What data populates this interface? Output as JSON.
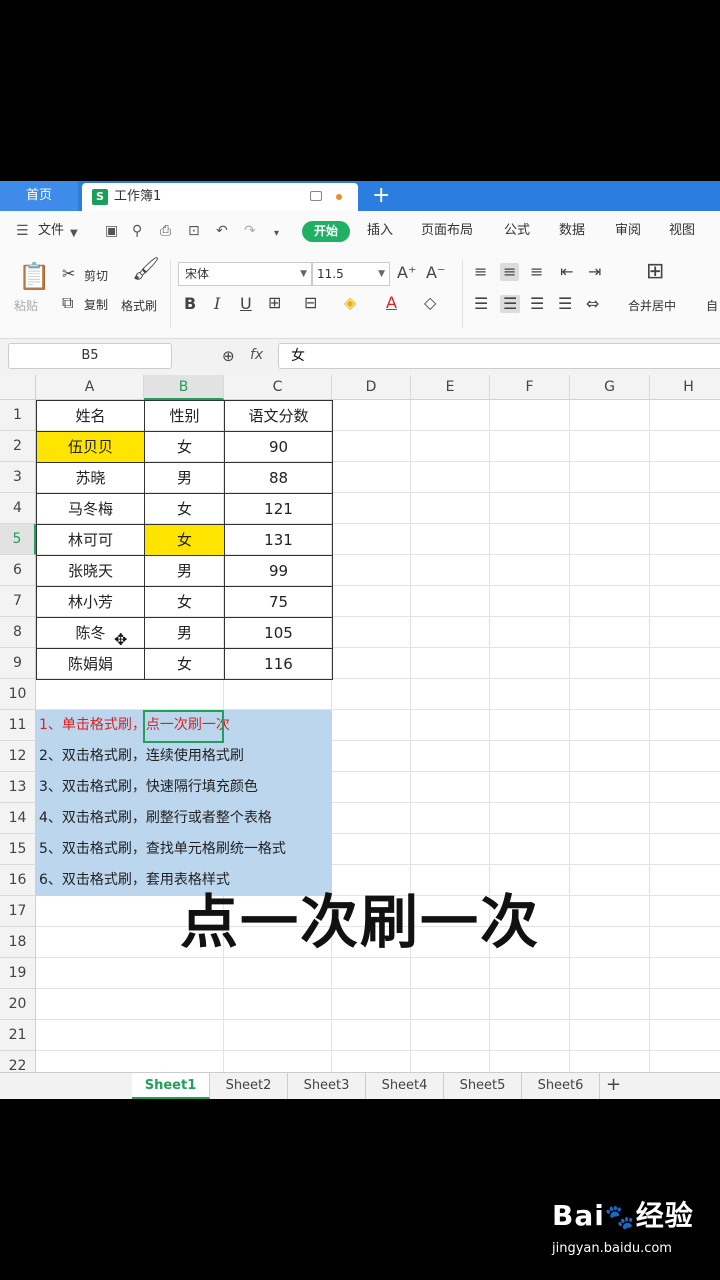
{
  "tabs": {
    "home": "首页",
    "doc": "工作簿1",
    "new_tab": "+"
  },
  "menu": {
    "file": "文件",
    "items": [
      "开始",
      "插入",
      "页面布局",
      "公式",
      "数据",
      "审阅",
      "视图"
    ]
  },
  "toolbar": {
    "paste": "粘贴",
    "cut": "剪切",
    "copy": "复制",
    "format_painter": "格式刷",
    "font": "宋体",
    "font_size": "11.5",
    "bold": "B",
    "italic": "I",
    "underline": "U",
    "merge": "合并居中",
    "auto": "自"
  },
  "formula_bar": {
    "name_box": "B5",
    "fx": "fx",
    "value": "女"
  },
  "columns": [
    "A",
    "B",
    "C",
    "D",
    "E",
    "F",
    "G",
    "H"
  ],
  "rows": [
    "1",
    "2",
    "3",
    "4",
    "5",
    "6",
    "7",
    "8",
    "9",
    "10",
    "11",
    "12",
    "13",
    "14",
    "15",
    "16",
    "17",
    "18",
    "19",
    "20",
    "21",
    "22"
  ],
  "table": {
    "headers": [
      "姓名",
      "性别",
      "语文分数"
    ],
    "rows": [
      [
        "伍贝贝",
        "女",
        "90"
      ],
      [
        "苏晓",
        "男",
        "88"
      ],
      [
        "马冬梅",
        "女",
        "121"
      ],
      [
        "林可可",
        "女",
        "131"
      ],
      [
        "张晓天",
        "男",
        "99"
      ],
      [
        "林小芳",
        "女",
        "75"
      ],
      [
        "陈冬",
        "男",
        "105"
      ],
      [
        "陈娟娟",
        "女",
        "116"
      ]
    ]
  },
  "notes": [
    "1、单击格式刷，点一次刷一次",
    "2、双击格式刷，连续使用格式刷",
    "3、双击格式刷，快速隔行填充颜色",
    "4、双击格式刷，刷整行或者整个表格",
    "5、双击格式刷，查找单元格刷统一格式",
    "6、双击格式刷，套用表格样式"
  ],
  "overlay_caption": "点一次刷一次",
  "sheets": [
    "Sheet1",
    "Sheet2",
    "Sheet3",
    "Sheet4",
    "Sheet5",
    "Sheet6"
  ],
  "active_sheet": "Sheet1",
  "watermark": {
    "brand": "Bai",
    "brand2": "经验",
    "url": "jingyan.baidu.com"
  },
  "colors": {
    "accent_green": "#20b064",
    "tab_blue": "#2b7de0",
    "highlight_yellow": "#ffe400",
    "note_blue": "#bcd6ee",
    "note_red": "#e02020"
  }
}
